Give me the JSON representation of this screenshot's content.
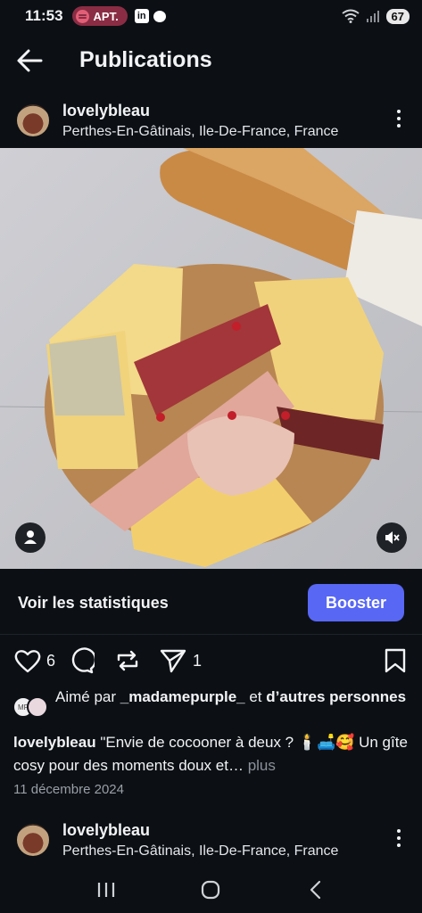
{
  "status": {
    "time": "11:53",
    "spotify_label": "APT.",
    "linkedin_glyph": "in",
    "battery": "67",
    "icons": [
      "spotify-icon",
      "linkedin-icon",
      "chat-icon",
      "wifi-icon",
      "signal-icon",
      "battery-icon"
    ]
  },
  "header": {
    "title": "Publications",
    "back_icon": "arrow-left-icon"
  },
  "post": {
    "username": "lovelybleau",
    "location": "Perthes-En-Gâtinais, Ile-De-France, France",
    "stats_label": "Voir les statistiques",
    "boost_label": "Booster",
    "like_count": "6",
    "share_count": "1",
    "liked_by_prefix": "Aimé par",
    "liked_by_user": "_madamepurple_",
    "liked_by_conj": "et",
    "liked_by_rest": "d’autres personnes",
    "liker_initials": "MP",
    "caption_user": "lovelybleau",
    "caption_text": "\"Envie de cocooner à deux ? 🕯️🛋️🥰 Un gîte cosy pour des moments doux et…",
    "caption_more": "plus",
    "date": "11 décembre 2024"
  },
  "next_post": {
    "username": "lovelybleau",
    "location": "Perthes-En-Gâtinais, Ile-De-France, France"
  },
  "colors": {
    "background": "#0c1015",
    "accent": "#5867f4",
    "spotify_pill": "#8a2d44"
  }
}
